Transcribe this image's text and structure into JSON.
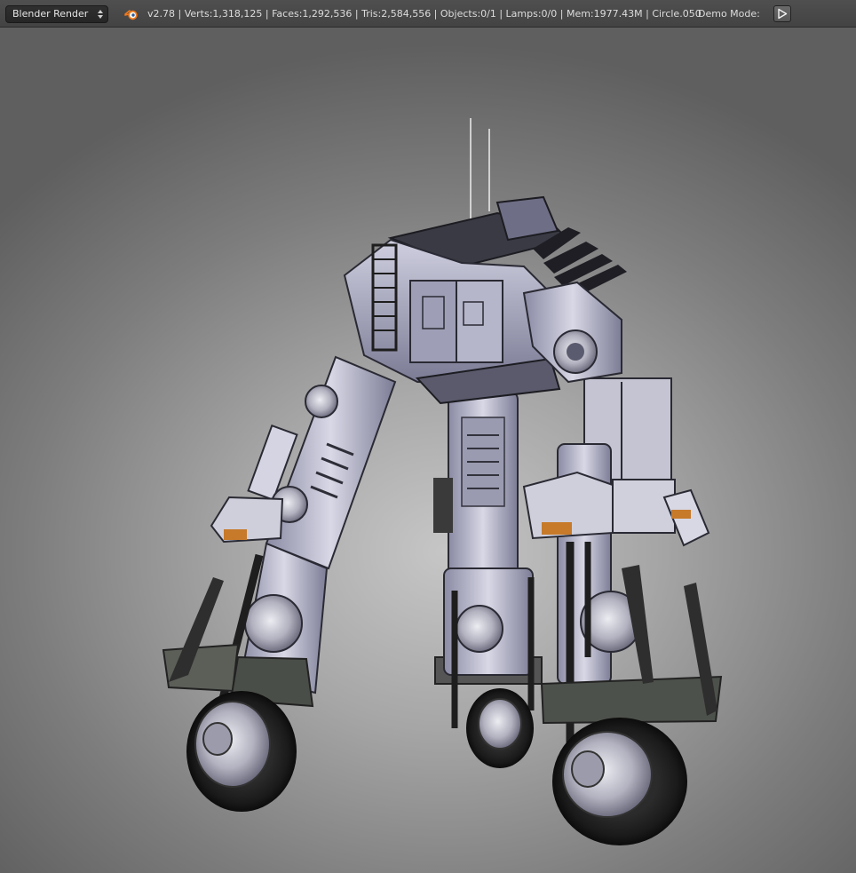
{
  "header": {
    "render_engine": "Blender Render",
    "stats": "v2.78 | Verts:1,318,125 | Faces:1,292,536 | Tris:2,584,556 | Objects:0/1 | Lamps:0/0 | Mem:1977.43M | Circle.050",
    "demo_mode_label": "Demo Mode:",
    "play_icon": "play-icon",
    "logo_icon": "blender-logo-icon"
  },
  "viewport": {
    "object_name": "Circle.050"
  }
}
